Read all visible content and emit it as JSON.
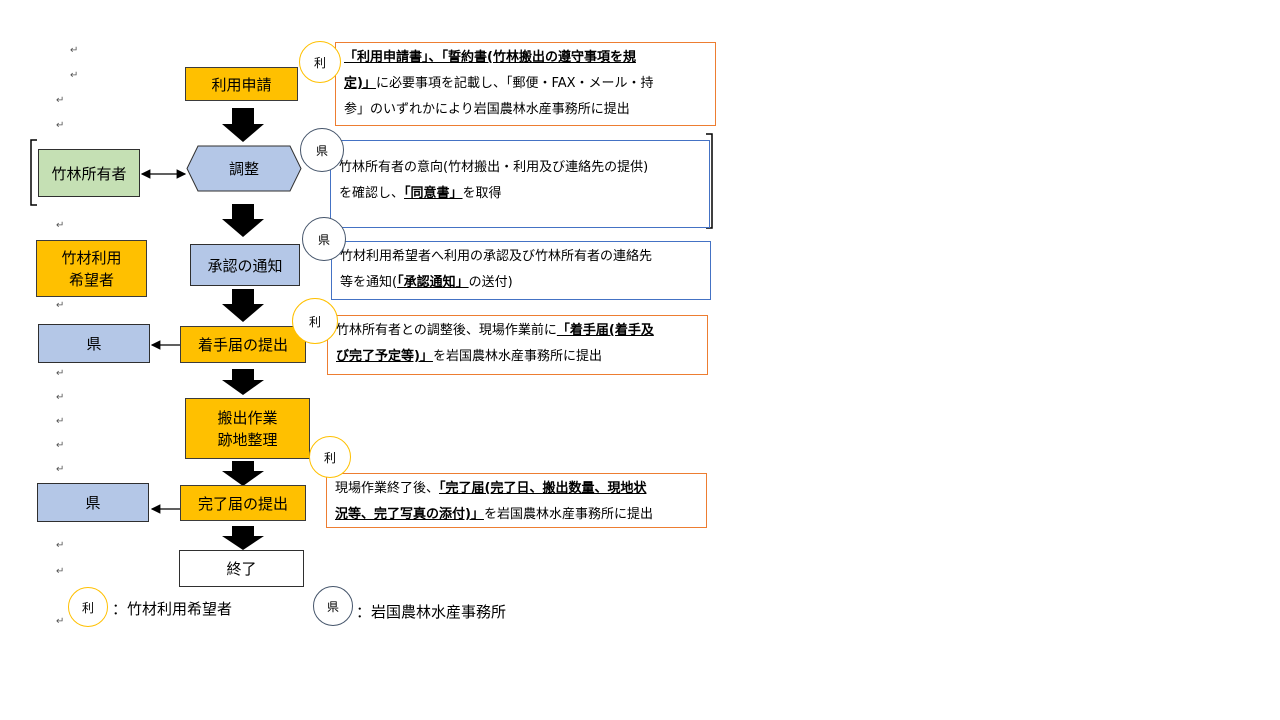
{
  "flow": {
    "apply": "利用申請",
    "adjust": "調整",
    "approval_notice": "承認の通知",
    "start_notice": "着手届の提出",
    "work": [
      "搬出作業",
      "跡地整理"
    ],
    "complete_notice": "完了届の提出",
    "end": "終了"
  },
  "side": {
    "owner": "竹林所有者",
    "applicant": [
      "竹材利用",
      "希望者"
    ],
    "pref1": "県",
    "pref2": "県"
  },
  "badges": {
    "ri": "利",
    "ken": "県"
  },
  "notes": {
    "n1": {
      "l1_u": "「利用申請書」、「誓約書(竹林搬出の遵守事項を規",
      "l2_u": "定)」",
      "l2_t": "に必要事項を記載し、「郵便・FAX・メール・持",
      "l3_t": "参」のいずれかにより岩国農林水産事務所に提出"
    },
    "n2": {
      "l1_t": "竹林所有者の意向(竹材搬出・利用及び連絡先の提供)",
      "l2_a": "を確認し、",
      "l2_u": "「同意書」",
      "l2_b": "を取得"
    },
    "n3": {
      "l1_t": "竹材利用希望者へ利用の承認及び竹林所有者の連絡先",
      "l2_a": "等を通知(",
      "l2_u": "「承認通知」",
      "l2_b": "の送付)"
    },
    "n4": {
      "l1_a": "竹林所有者との調整後、現場作業前に",
      "l1_u": "「着手届(着手及",
      "l2_u": "び完了予定等)」",
      "l2_b": "を岩国農林水産事務所に提出"
    },
    "n5": {
      "l1_a": "現場作業終了後、",
      "l1_u": "「完了届(完了日、搬出数量、現地状",
      "l2_u": "況等、完了写真の添付)」",
      "l2_b": "を岩国農林水産事務所に提出"
    }
  },
  "legend": {
    "ri_label": "：竹材利用希望者",
    "ken_label": "：岩国農林水産事務所"
  },
  "colors": {
    "orange": "#FFC000",
    "blue": "#B4C7E7",
    "green": "#C5E0B4",
    "note_orange": "#ED7D31",
    "note_blue": "#4472C4"
  }
}
